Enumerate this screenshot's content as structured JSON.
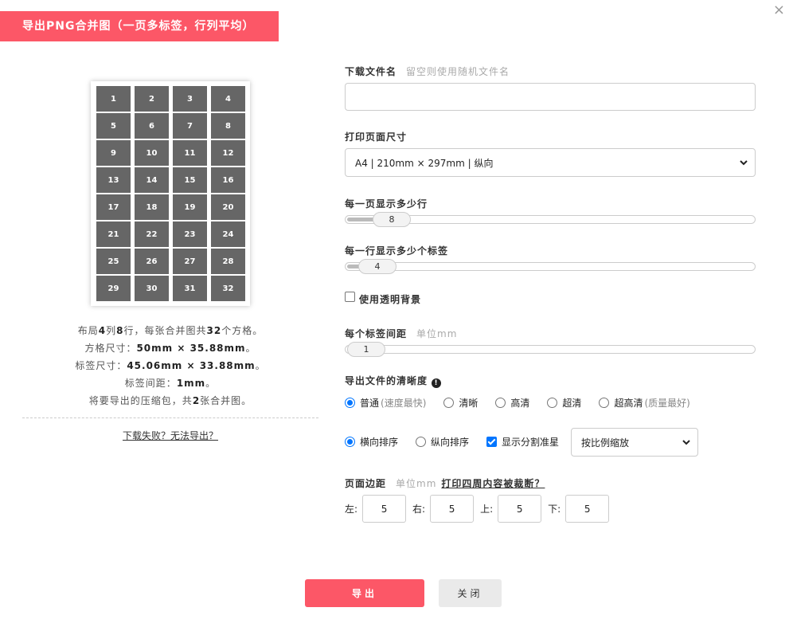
{
  "dialog": {
    "title": "导出PNG合并图（一页多标签，行列平均）",
    "close_icon": "×"
  },
  "preview": {
    "cells": [
      "1",
      "2",
      "3",
      "4",
      "5",
      "6",
      "7",
      "8",
      "9",
      "10",
      "11",
      "12",
      "13",
      "14",
      "15",
      "16",
      "17",
      "18",
      "19",
      "20",
      "21",
      "22",
      "23",
      "24",
      "25",
      "26",
      "27",
      "28",
      "29",
      "30",
      "31",
      "32"
    ],
    "info": {
      "line1_a": "布局",
      "cols": "4",
      "line1_b": "列",
      "rows": "8",
      "line1_c": "行，每张合并图共",
      "total": "32",
      "line1_d": "个方格。",
      "line2_label": "方格尺寸：",
      "line2_value": "50mm × 35.88mm",
      "line2_end": "。",
      "line3_label": "标签尺寸：",
      "line3_value": "45.06mm × 33.88mm",
      "line3_end": "。",
      "line4_label": "标签间距：",
      "line4_value": "1mm",
      "line4_end": "。",
      "line5_a": "将要导出的压缩包，共",
      "line5_count": "2",
      "line5_b": "张合并图。"
    },
    "fail_link": "下载失败？无法导出？"
  },
  "form": {
    "filename_label": "下载文件名",
    "filename_hint": "留空则使用随机文件名",
    "filename_value": "",
    "page_size_label": "打印页面尺寸",
    "page_size_value": "A4 | 210mm × 297mm | 纵向",
    "rows_label": "每一页显示多少行",
    "rows_value": "8",
    "rows_fraction": 0.12,
    "cols_label": "每一行显示多少个标签",
    "cols_value": "4",
    "cols_fraction": 0.06,
    "transparent_label": "使用透明背景",
    "gap_label": "每个标签间距",
    "gap_hint": "单位mm",
    "gap_value": "1",
    "gap_fraction": 0.02,
    "quality_label": "导出文件的清晰度",
    "quality_info_icon": "!",
    "quality_options": [
      {
        "label": "普通",
        "sub": "(速度最快)",
        "selected": true
      },
      {
        "label": "清晰",
        "sub": "",
        "selected": false
      },
      {
        "label": "高清",
        "sub": "",
        "selected": false
      },
      {
        "label": "超清",
        "sub": "",
        "selected": false
      },
      {
        "label": "超高清",
        "sub": "(质量最好)",
        "selected": false
      }
    ],
    "sort_horizontal": "横向排序",
    "sort_vertical": "纵向排序",
    "show_divider": "显示分割准星",
    "scale_value": "按比例缩放",
    "margin_label": "页面边距",
    "margin_hint": "单位mm",
    "margin_link": "打印四周内容被裁断？",
    "margin_left_label": "左:",
    "margin_left": "5",
    "margin_right_label": "右:",
    "margin_right": "5",
    "margin_top_label": "上:",
    "margin_top": "5",
    "margin_bottom_label": "下:",
    "margin_bottom": "5"
  },
  "buttons": {
    "export": "导出",
    "close": "关闭"
  },
  "colors": {
    "accent": "#fc5767",
    "radio_blue": "#0075ff",
    "cell_gray": "#666666"
  }
}
